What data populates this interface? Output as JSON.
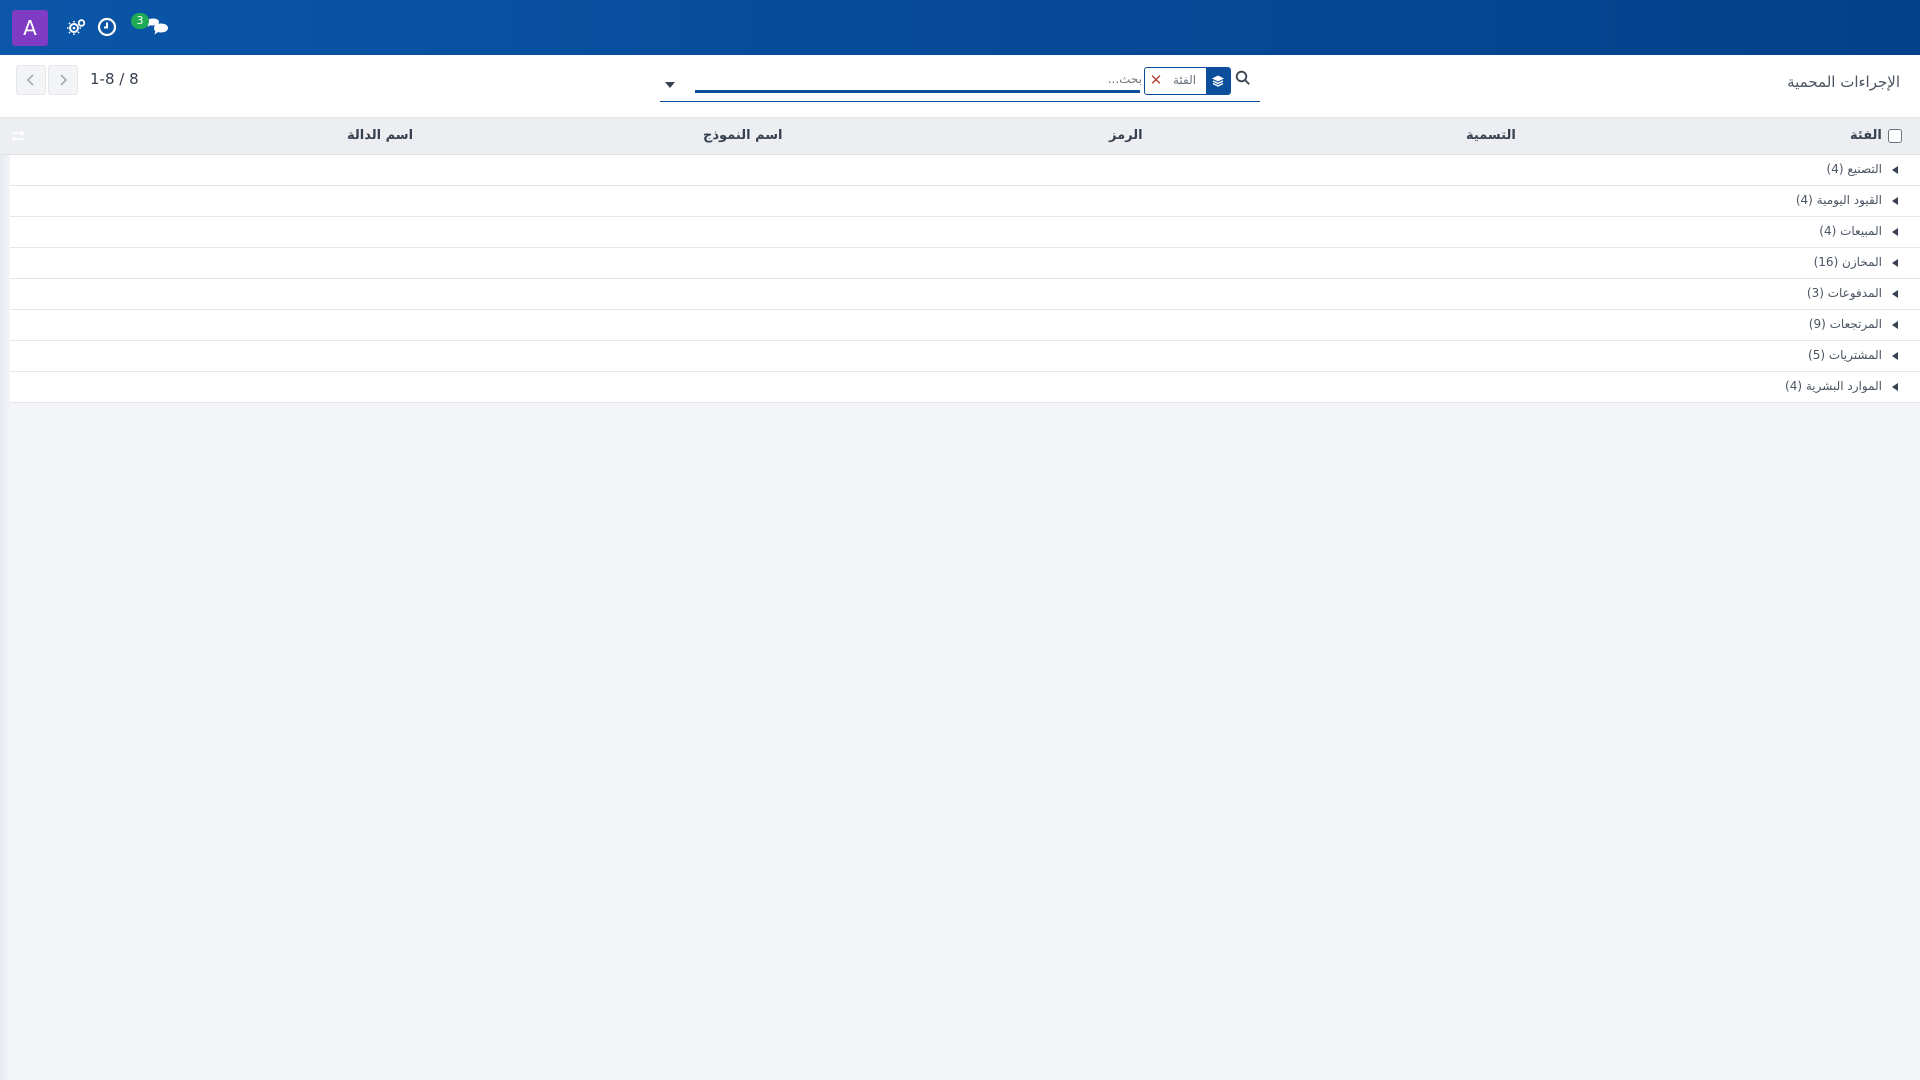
{
  "navbar": {
    "avatar_letter": "A",
    "avatar_color": "#7d3cc3",
    "brand_color": "#0b56a8",
    "icons": [
      "settings-gears-icon",
      "clock-icon",
      "chat-icon"
    ],
    "messages_badge": "3"
  },
  "control": {
    "breadcrumb": "الإجراءات المحمية",
    "pager": "1-8 / 8",
    "search": {
      "placeholder": "بحث...",
      "facet_value": "الفئة",
      "facet_icon": "group-by-layers-icon"
    }
  },
  "table": {
    "headers": {
      "category": "الفئة",
      "label": "التسمية",
      "code": "الرمز",
      "model_name": "اسم النموذج",
      "function_name": "اسم الدالة"
    },
    "groups": [
      {
        "label": "التصنيع (4)"
      },
      {
        "label": "القيود اليومية (4)"
      },
      {
        "label": "المبيعات (4)"
      },
      {
        "label": "المخازن (16)"
      },
      {
        "label": "المدفوعات (3)"
      },
      {
        "label": "المرتجعات (9)"
      },
      {
        "label": "المشتريات (5)"
      },
      {
        "label": "الموارد البشرية (4)"
      }
    ]
  }
}
